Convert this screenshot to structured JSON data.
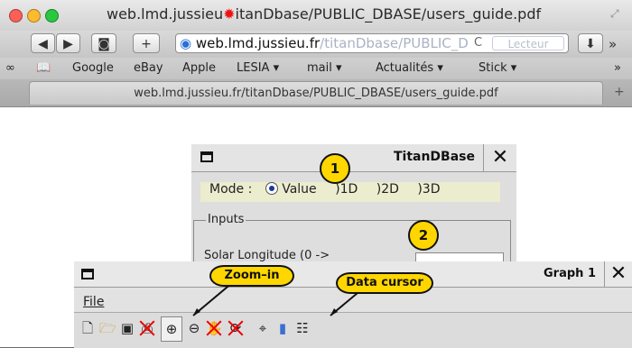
{
  "browser": {
    "window_title_host": "web.lmd.jussieu",
    "window_title_path": "itanDbase/PUBLIC_DBASE/users_guide.pdf",
    "url_host": "web.lmd.jussieu.fr",
    "url_path": "/titanDbase/PUBLIC_D",
    "reader_label": "Lecteur",
    "nav_back": "◀",
    "nav_forward": "▶",
    "add_label": "+",
    "reload": "C",
    "more": "»",
    "bookmarks": [
      "Google",
      "eBay",
      "Apple",
      "LESIA ▾",
      "mail ▾",
      "Actualités ▾",
      "Stick ▾"
    ],
    "bookmarks_more": "»",
    "tab_title": "web.lmd.jussieu.fr/titanDbase/PUBLIC_DBASE/users_guide.pdf",
    "new_tab": "+"
  },
  "titan_window": {
    "title": "TitanDBase",
    "close": "✕",
    "mode_label": "Mode :",
    "modes": [
      "Value",
      ")1D",
      ")2D",
      ")3D"
    ],
    "inputs_legend": "Inputs",
    "solar_label": "Solar Longitude (0 ->",
    "callout_1": "1",
    "callout_2": "2"
  },
  "graph_window": {
    "title": "Graph 1",
    "close": "✕",
    "file_menu": "File",
    "zoom_in_callout": "Zoom–in",
    "data_cursor_callout": "Data cursor"
  },
  "colors": {
    "callout": "#ffd600",
    "x_mark": "#e00000"
  }
}
